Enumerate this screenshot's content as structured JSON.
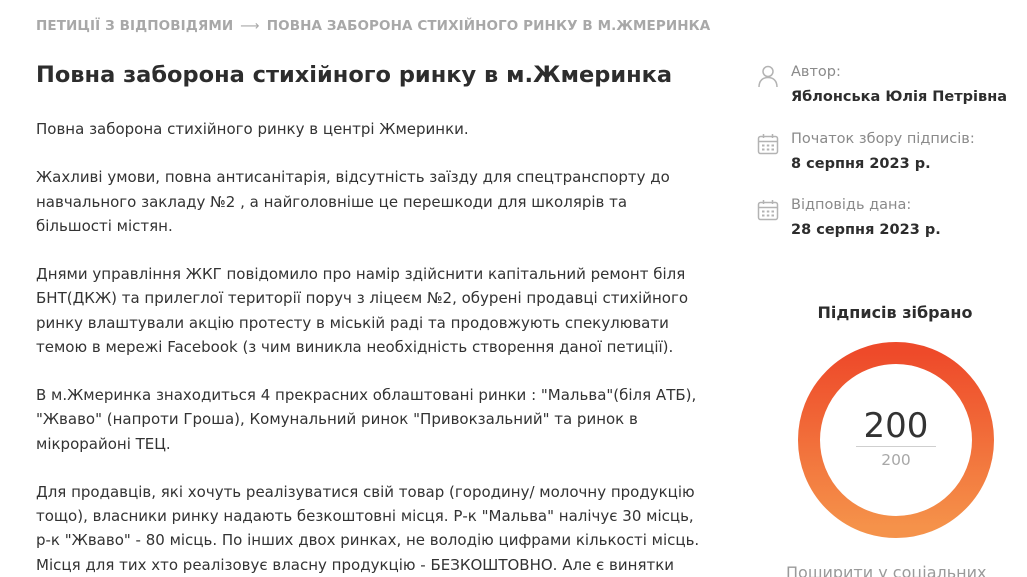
{
  "breadcrumb": {
    "parent": "ПЕТИЦІЇ З ВІДПОВІДЯМИ",
    "separator": "⟶",
    "current": "ПОВНА ЗАБОРОНА СТИХІЙНОГО РИНКУ В М.ЖМЕРИНКА"
  },
  "petition": {
    "title": "Повна заборона стихійного ринку в м.Жмеринка",
    "paragraphs": [
      [
        "Повна заборона стихійного ринку в центрі Жмеринки."
      ],
      [
        "Жахливі умови, повна антисанітарія, відсутність заїзду для спецтранспорту до",
        "навчального закладу №2 , а найголовніше це перешкоди для школярів та",
        "більшості містян."
      ],
      [
        "Днями управління ЖКГ повідомило про намір здійснити капітальний ремонт біля",
        "БНТ(ДКЖ) та прилеглої території поруч з ліцеєм №2, обурені продавці стихійного",
        "ринку влаштували акцію протесту в міській раді та продовжують спекулювати",
        "темою в мережі Facebook (з чим виникла необхідність створення даної петиції)."
      ],
      [
        "В м.Жмеринка знаходиться 4 прекрасних облаштовані ринки : \"Мальва\"(біля АТБ),",
        "\"Жваво\" (напроти Гроша), Комунальний ринок \"Привокзальний\" та ринок в",
        "мікрорайоні ТЕЦ."
      ],
      [
        "Для продавців, які хочуть реалізуватися свій товар (городину/ молочну продукцію",
        "тощо), власники ринку надають безкоштовні місця. Р-к \"Мальва\" налічує 30 місць,",
        "р-к \"Жваво\" - 80 місць. По інших двох ринках, не володію цифрами кількості місць.",
        "Місця для тих хто реалізовує власну продукцію - БЕЗКОШТОВНО. Але є винятки"
      ]
    ]
  },
  "meta": {
    "author_label": "Автор:",
    "author_value": "Яблонська Юлія Петрівна",
    "start_label": "Початок збору підписів:",
    "start_value": "8 серпня 2023 р.",
    "answer_label": "Відповідь дана:",
    "answer_value": "28 серпня 2023 р."
  },
  "signatures": {
    "heading": "Підписів зібрано",
    "collected": "200",
    "target": "200",
    "progress": 1.0,
    "colors": {
      "start": "#f5924a",
      "end": "#ee4a2a"
    }
  },
  "share": {
    "label": "Поширити у соціальних"
  },
  "icons": {
    "author": "user-icon",
    "start": "calendar-icon",
    "answer": "calendar-icon"
  }
}
